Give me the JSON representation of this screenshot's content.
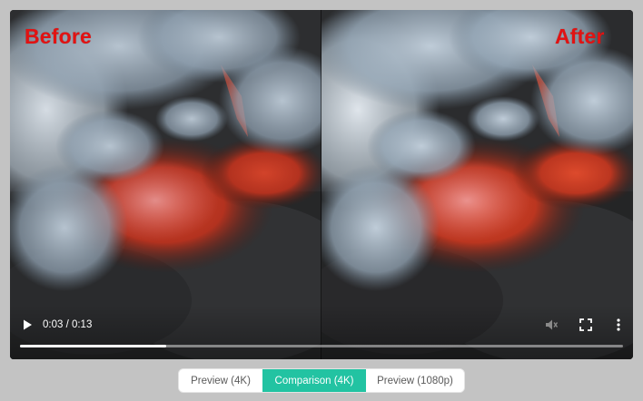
{
  "video": {
    "before_label": "Before",
    "after_label": "After",
    "time_display": "0:03 / 0:13",
    "progress_fraction": 0.242
  },
  "icons": {
    "play": "play-icon",
    "mute": "volume-muted-icon",
    "fullscreen": "fullscreen-icon",
    "more": "more-vertical-icon"
  },
  "tabs": [
    {
      "label": "Preview (4K)",
      "active": false
    },
    {
      "label": "Comparison (4K)",
      "active": true
    },
    {
      "label": "Preview (1080p)",
      "active": false
    }
  ],
  "colors": {
    "overlay_label": "#e21212",
    "active_tab": "#22c3a2"
  }
}
